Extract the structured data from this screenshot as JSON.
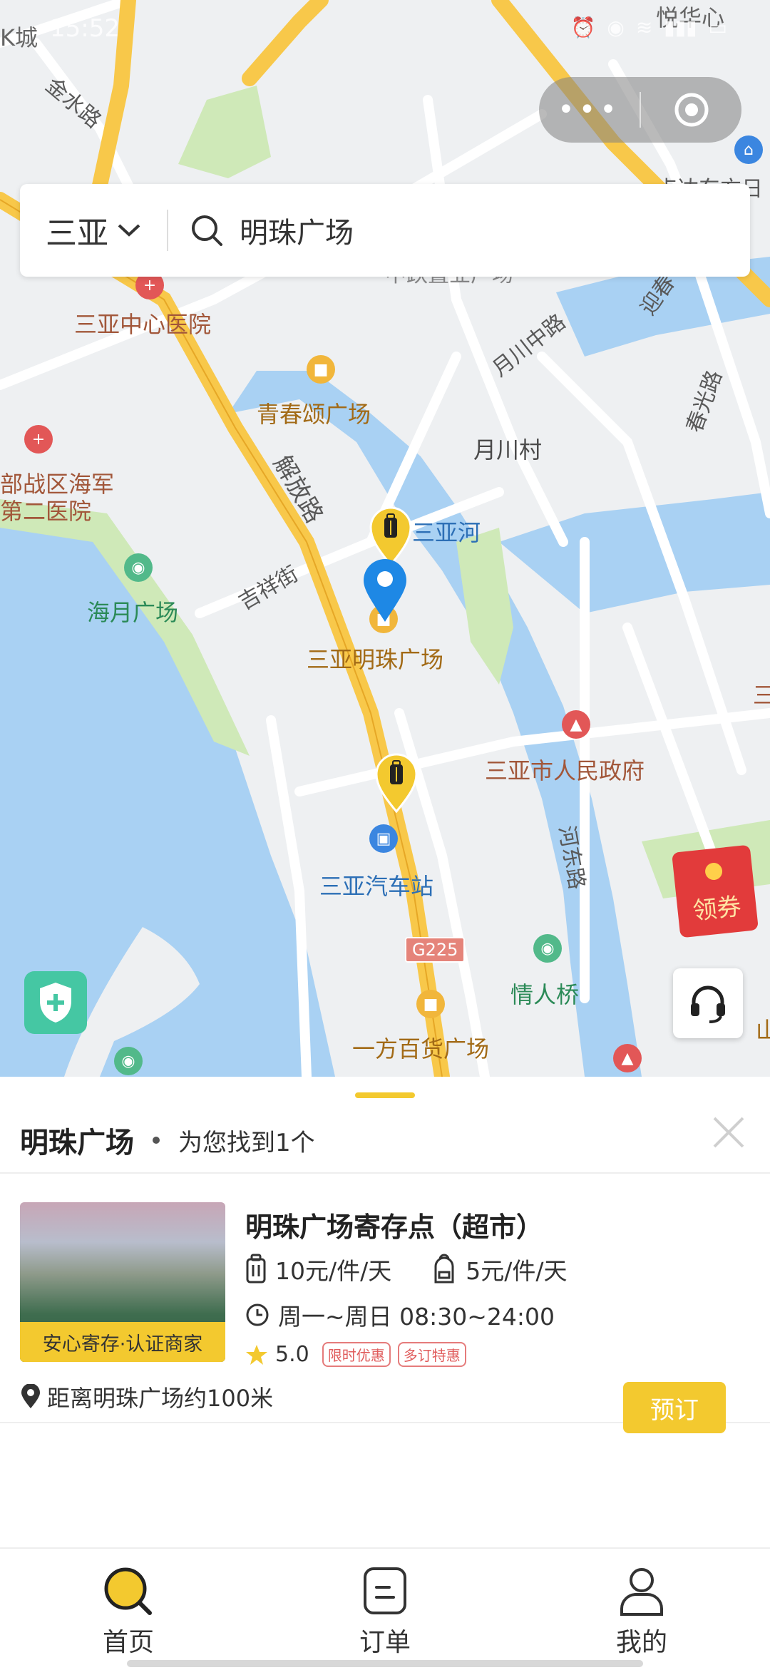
{
  "status_bar": {
    "time": "15:52",
    "icons": [
      "alarm-icon",
      "location-icon",
      "wifi-icon",
      "signal-icon",
      "battery-icon"
    ]
  },
  "capsule": {
    "more_label": "•••"
  },
  "search": {
    "city": "三亚",
    "query": "明珠广场"
  },
  "map": {
    "labels": {
      "top_left": "K城",
      "top_right": "悦华心",
      "top_right2": "点达东方日",
      "jinshui_road": "金水路",
      "hospital": "三亚中心医院",
      "qingchun_plaza": "青春颂广场",
      "yuechuan_road": "月川中路",
      "yingbin_road": "迎春",
      "chunguang_road": "春光路",
      "yuechuan_village": "月川村",
      "navy_hospital_1": "部战区海军",
      "navy_hospital_2": "第二医院",
      "jiefang_road": "解放路",
      "sanya_river": "三亚河",
      "jixiang_street": "吉祥街",
      "haiyue_plaza": "海月广场",
      "mingzhu_plaza": "三亚明珠广场",
      "city_gov": "三亚市人民政府",
      "hedong_road": "河东路",
      "bus_station": "三亚汽车站",
      "g225": "G225",
      "lovers_bridge": "情人桥",
      "yifang_plaza": "一方百货广场",
      "top_partial": "中跃置业广场",
      "edge_right": "三",
      "edge_right2": "山"
    },
    "coupon_label": "领券"
  },
  "result_sheet": {
    "title": "明珠广场",
    "count_text": "为您找到1个",
    "card": {
      "name": "明珠广场寄存点（超市）",
      "badge": "安心寄存·认证商家",
      "price_large": "10元/件/天",
      "price_small": "5元/件/天",
      "hours": "周一~周日 08:30~24:00",
      "rating": "5.0",
      "tags": [
        "限时优惠",
        "多订特惠"
      ],
      "distance": "距离明珠广场约100米",
      "book_label": "预订"
    }
  },
  "tabbar": {
    "items": [
      {
        "label": "首页",
        "icon": "search-icon",
        "active": true
      },
      {
        "label": "订单",
        "icon": "order-icon",
        "active": false
      },
      {
        "label": "我的",
        "icon": "user-icon",
        "active": false
      }
    ]
  },
  "colors": {
    "accent": "#f3c92f",
    "water": "#a9d1f3",
    "road": "#f8c84a",
    "pin_blue": "#1e88e5"
  }
}
